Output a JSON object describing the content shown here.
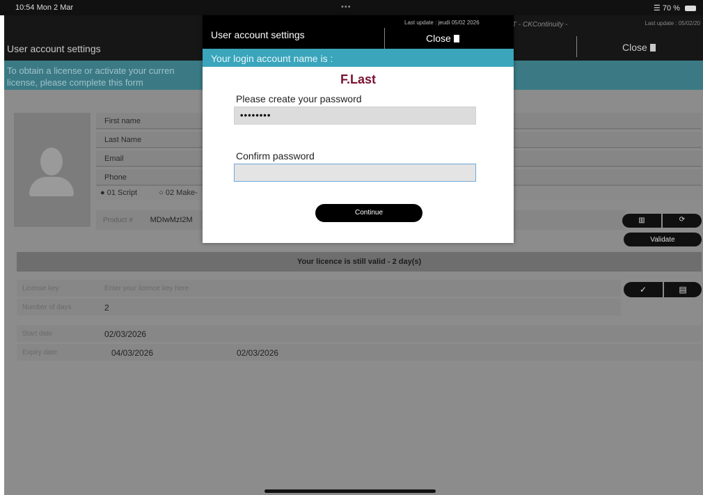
{
  "statusbar": {
    "time": "10:54  Mon 2 Mar",
    "dots": "•••",
    "battery": "70 %"
  },
  "background": {
    "title": "User account settings",
    "app_subtitle": "T - CKContinuity -",
    "last_update": "Last update : 05/02/20",
    "close_label": "Close",
    "banner_line1": "To obtain a license or activate your curren",
    "banner_line2": "license, please complete this form",
    "fields": [
      "First name",
      "Last Name",
      "Email",
      "Phone"
    ],
    "radios": [
      "01  Script",
      "02  Make-"
    ],
    "product_label": "Product #",
    "product_value": "MDIwMzI2M",
    "validate_label": "Validate",
    "valid_message": "Your licence is still valid - 2 day(s)",
    "license_key_label": "License key",
    "license_key_placeholder": "Enter your licence key here",
    "number_of_days_label": "Number of days",
    "number_of_days_value": "2",
    "start_date_label": "Start date",
    "start_date_value": "02/03/2026",
    "expiry_date_label": "Expiry date",
    "expiry_date_value": "04/03/2026",
    "expiry_date_value2": "02/03/2026"
  },
  "modal": {
    "title": "User account settings",
    "last_update": "Last update : jeudi 05/02 2026",
    "close_label": "Close",
    "banner": "Your login account name is :",
    "login_name": "F.Last",
    "password_label": "Please create your password",
    "password_value": "••••••••",
    "confirm_label": "Confirm password",
    "confirm_value": "",
    "continue_label": "Continue"
  },
  "colors": {
    "accent": "#3aa5bb",
    "login_name": "#7a1230",
    "header": "#000000"
  }
}
